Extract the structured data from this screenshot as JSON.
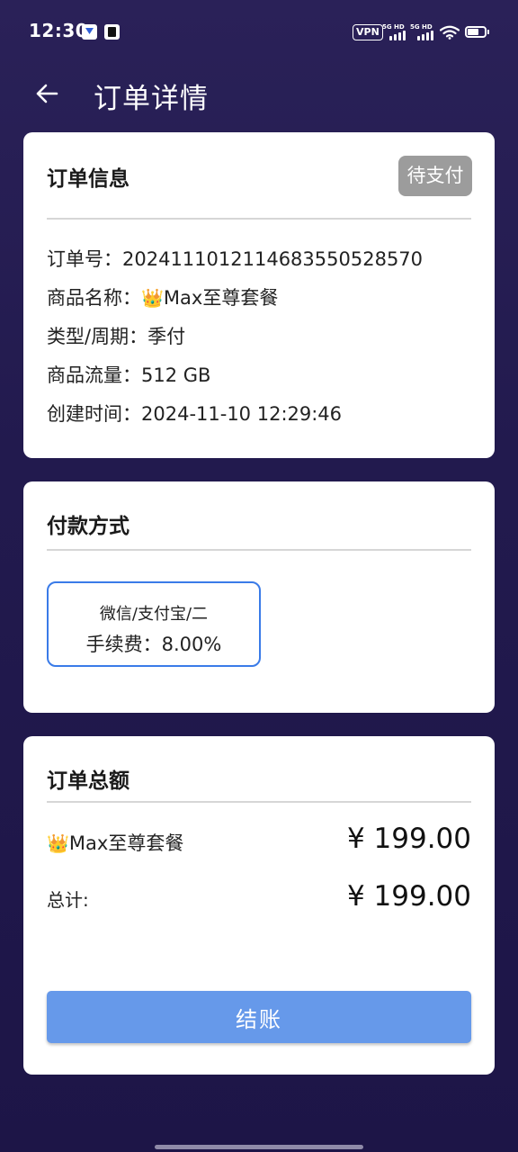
{
  "status_bar": {
    "time": "12:30",
    "vpn": "VPN",
    "sim1_tag": "5G HD",
    "sim2_tag": "5G HD",
    "icons": [
      "notification-icon",
      "notification-icon",
      "signal-icon",
      "signal-icon",
      "wifi-icon",
      "battery-icon"
    ]
  },
  "header": {
    "back_icon": "arrow-left-icon",
    "title": "订单详情"
  },
  "order_info": {
    "title": "订单信息",
    "status": "待支付",
    "order_no": "订单号：2024111012114683550528570",
    "product_label": "商品名称：",
    "crown": "👑",
    "product_name": "Max至尊套餐",
    "cycle": "类型/周期：季付",
    "traffic": "商品流量：512 GB",
    "created": "创建时间：2024-11-10 12:29:46"
  },
  "payment": {
    "title": "付款方式",
    "method_name": "微信/支付宝/二",
    "method_fee": "手续费：8.00%"
  },
  "total": {
    "title": "订单总额",
    "crown": "👑",
    "item_name": "Max至尊套餐",
    "item_price": "¥ 199.00",
    "sum_label": "总计:",
    "sum_value": "¥ 199.00",
    "checkout_label": "结账"
  },
  "colors": {
    "background": "#231a50",
    "accent": "#3a7be8",
    "button": "#6699ea",
    "badge": "#9c9c9c"
  }
}
